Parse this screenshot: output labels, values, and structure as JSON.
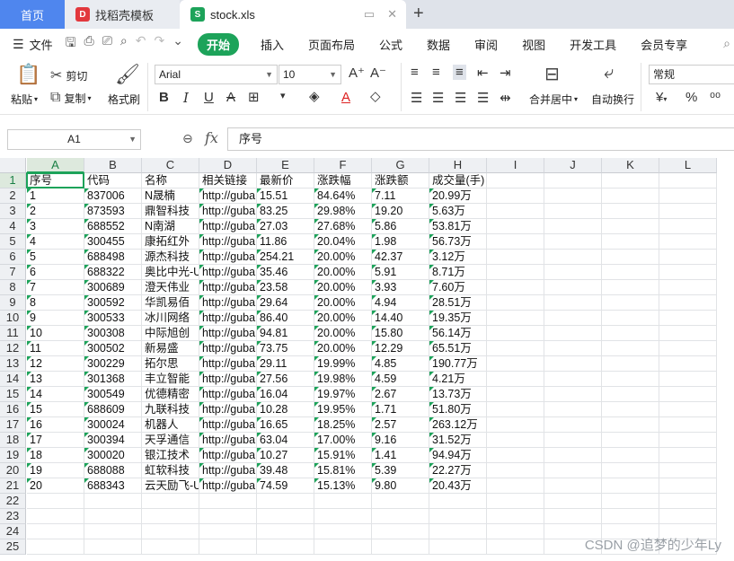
{
  "tabs": {
    "home": "首页",
    "template": "找稻壳模板",
    "file": "stock.xls",
    "add": "+"
  },
  "menu": {
    "file_label": "文件",
    "items": [
      "开始",
      "插入",
      "页面布局",
      "公式",
      "数据",
      "审阅",
      "视图",
      "开发工具",
      "会员专享"
    ],
    "active": "开始"
  },
  "ribbon": {
    "paste": "粘贴",
    "cut": "剪切",
    "copy": "复制",
    "format_painter": "格式刷",
    "font_name": "Arial",
    "font_size": "10",
    "merge_center": "合并居中",
    "wrap_text": "自动换行",
    "number_format": "常规",
    "currency_symbol": "¥",
    "percent_symbol": "%"
  },
  "formula_bar": {
    "name_box": "A1",
    "fx": "fx",
    "content": "序号"
  },
  "sheet": {
    "columns": [
      "A",
      "B",
      "C",
      "D",
      "E",
      "F",
      "G",
      "H",
      "I",
      "J",
      "K",
      "L"
    ],
    "row_numbers": [
      "1",
      "2",
      "3",
      "4",
      "5",
      "6",
      "7",
      "8",
      "9",
      "10",
      "11",
      "12",
      "13",
      "14",
      "15",
      "16",
      "17",
      "18",
      "19",
      "20",
      "21",
      "22",
      "23",
      "24",
      "25"
    ],
    "header": [
      "序号",
      "代码",
      "名称",
      "相关链接",
      "最新价",
      "涨跌幅",
      "涨跌额",
      "成交量(手)"
    ],
    "rows": [
      [
        "1",
        "837006",
        "N晟楠",
        "http://guba",
        "15.51",
        "84.64%",
        "7.11",
        "20.99万"
      ],
      [
        "2",
        "873593",
        "鼎智科技",
        "http://guba",
        "83.25",
        "29.98%",
        "19.20",
        "5.63万"
      ],
      [
        "3",
        "688552",
        "N南湖",
        "http://guba",
        "27.03",
        "27.68%",
        "5.86",
        "53.81万"
      ],
      [
        "4",
        "300455",
        "康拓红外",
        "http://guba",
        "11.86",
        "20.04%",
        "1.98",
        "56.73万"
      ],
      [
        "5",
        "688498",
        "源杰科技",
        "http://guba",
        "254.21",
        "20.00%",
        "42.37",
        "3.12万"
      ],
      [
        "6",
        "688322",
        "奥比中光-U",
        "http://guba",
        "35.46",
        "20.00%",
        "5.91",
        "8.71万"
      ],
      [
        "7",
        "300689",
        "澄天伟业",
        "http://guba",
        "23.58",
        "20.00%",
        "3.93",
        "7.60万"
      ],
      [
        "8",
        "300592",
        "华凯易佰",
        "http://guba",
        "29.64",
        "20.00%",
        "4.94",
        "28.51万"
      ],
      [
        "9",
        "300533",
        "冰川网络",
        "http://guba",
        "86.40",
        "20.00%",
        "14.40",
        "19.35万"
      ],
      [
        "10",
        "300308",
        "中际旭创",
        "http://guba",
        "94.81",
        "20.00%",
        "15.80",
        "56.14万"
      ],
      [
        "11",
        "300502",
        "新易盛",
        "http://guba",
        "73.75",
        "20.00%",
        "12.29",
        "65.51万"
      ],
      [
        "12",
        "300229",
        "拓尔思",
        "http://guba",
        "29.11",
        "19.99%",
        "4.85",
        "190.77万"
      ],
      [
        "13",
        "301368",
        "丰立智能",
        "http://guba",
        "27.56",
        "19.98%",
        "4.59",
        "4.21万"
      ],
      [
        "14",
        "300549",
        "优德精密",
        "http://guba",
        "16.04",
        "19.97%",
        "2.67",
        "13.73万"
      ],
      [
        "15",
        "688609",
        "九联科技",
        "http://guba",
        "10.28",
        "19.95%",
        "1.71",
        "51.80万"
      ],
      [
        "16",
        "300024",
        "机器人",
        "http://guba",
        "16.65",
        "18.25%",
        "2.57",
        "263.12万"
      ],
      [
        "17",
        "300394",
        "天孚通信",
        "http://guba",
        "63.04",
        "17.00%",
        "9.16",
        "31.52万"
      ],
      [
        "18",
        "300020",
        "银江技术",
        "http://guba",
        "10.27",
        "15.91%",
        "1.41",
        "94.94万"
      ],
      [
        "19",
        "688088",
        "虹软科技",
        "http://guba",
        "39.48",
        "15.81%",
        "5.39",
        "22.27万"
      ],
      [
        "20",
        "688343",
        "云天励飞-U",
        "http://guba",
        "74.59",
        "15.13%",
        "9.80",
        "20.43万"
      ]
    ]
  },
  "watermark": "CSDN @追梦的少年Ly",
  "colors": {
    "accent": "#1da35a",
    "home_tab": "#4f86ee"
  }
}
